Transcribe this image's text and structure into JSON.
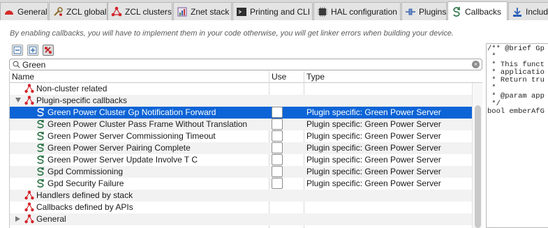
{
  "tabs": [
    {
      "label": "General",
      "icon": "general-icon"
    },
    {
      "label": "ZCL global",
      "icon": "zcl-global-icon"
    },
    {
      "label": "ZCL clusters",
      "icon": "zcl-clusters-icon"
    },
    {
      "label": "Znet stack",
      "icon": "znet-stack-icon"
    },
    {
      "label": "Printing and CLI",
      "icon": "printing-cli-icon"
    },
    {
      "label": "HAL configuration",
      "icon": "hal-configuration-icon"
    },
    {
      "label": "Plugins",
      "icon": "plugins-icon"
    },
    {
      "label": "Callbacks",
      "icon": "callbacks-icon",
      "active": true
    },
    {
      "label": "Includ",
      "icon": "includes-icon"
    }
  ],
  "description": "By enabling callbacks, you will have to implement them in your code otherwise, you will get linker errors when building your device.",
  "search": {
    "value": "Green",
    "placeholder": ""
  },
  "table": {
    "columns": [
      "Name",
      "Use",
      "Type"
    ],
    "rows": [
      {
        "name": "Non-cluster related",
        "type": "",
        "kind": "group",
        "level": 0,
        "twisty": "none"
      },
      {
        "name": "Plugin-specific callbacks",
        "type": "",
        "kind": "group",
        "level": 0,
        "twisty": "open"
      },
      {
        "name": "Green Power Cluster Gp Notification Forward",
        "type": "Plugin specific: Green Power Server",
        "kind": "callback",
        "level": 1,
        "selected": true,
        "checked": false
      },
      {
        "name": "Green Power Cluster Pass Frame Without Translation",
        "type": "Plugin specific: Green Power Server",
        "kind": "callback",
        "level": 1,
        "checked": false
      },
      {
        "name": "Green Power Server Commissioning Timeout",
        "type": "Plugin specific: Green Power Server",
        "kind": "callback",
        "level": 1,
        "checked": false
      },
      {
        "name": "Green Power Server Pairing Complete",
        "type": "Plugin specific: Green Power Server",
        "kind": "callback",
        "level": 1,
        "checked": false
      },
      {
        "name": "Green Power Server Update Involve T C",
        "type": "Plugin specific: Green Power Server",
        "kind": "callback",
        "level": 1,
        "checked": false
      },
      {
        "name": "Gpd Commissioning",
        "type": "Plugin specific: Green Power Server",
        "kind": "callback",
        "level": 1,
        "checked": false
      },
      {
        "name": "Gpd Security Failure",
        "type": "Plugin specific: Green Power Server",
        "kind": "callback",
        "level": 1,
        "checked": false
      },
      {
        "name": "Handlers defined by stack",
        "type": "",
        "kind": "group",
        "level": 0,
        "twisty": "none"
      },
      {
        "name": "Callbacks defined by APIs",
        "type": "",
        "kind": "group",
        "level": 0,
        "twisty": "none"
      },
      {
        "name": "General",
        "type": "",
        "kind": "group",
        "level": 0,
        "twisty": "closed"
      }
    ]
  },
  "code_preview": "/** @brief Gp\n *\n * This funct\n * applicatio\n * Return tru\n *\n * @param app\n */\nbool emberAfG",
  "colors": {
    "selection": "#0d64d6",
    "tree_icon": "#d4232a",
    "callback_icon": "#1d6b3a"
  }
}
